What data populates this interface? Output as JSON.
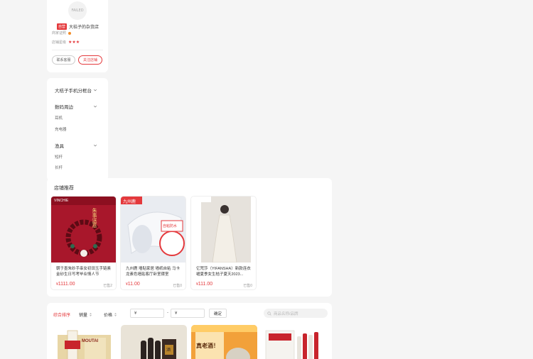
{
  "shop": {
    "logo_text": "FAILED",
    "badge": "自营",
    "name": "大桔子的杂货店",
    "rating_label_1": "商家证照",
    "rating_label_2": "店铺星级",
    "stars": "★★★",
    "btn_enter": "联系客服",
    "btn_follow": "关注店铺"
  },
  "category": {
    "header": "大桔子手机分框台",
    "group1": {
      "title": "数码周边",
      "items": [
        "耳机",
        "充电器"
      ]
    },
    "group2": {
      "title": "渔具",
      "items": [
        "短杆",
        "长杆"
      ]
    }
  },
  "recommend": {
    "title": "店铺推荐",
    "items": [
      {
        "brand": "VINCHIE",
        "img_text": "朱事送意",
        "name": "朝于墨朱砂手串女初田玉手链素金砂生日写考毕业情人节",
        "currency": "¥",
        "price": "1111.00",
        "sold": "已售2"
      },
      {
        "brand": "九州鹿",
        "img_text": "自粘防水",
        "name": "九州鹿 墙贴家居 墙纸自粘 马卡龙素色墙贴客厅卧室寝室",
        "currency": "¥",
        "price": "11.00",
        "sold": "已售0"
      },
      {
        "brand": "亿梵莎",
        "img_text": "",
        "name": "亿梵莎（YIFANSHA）新款连衣裙夏季女生桔子夏天2023...",
        "currency": "¥",
        "price": "111.00",
        "sold": "已售0"
      }
    ]
  },
  "filter": {
    "tab_all": "综合排序",
    "tab_sales": "销量",
    "tab_price": "价格",
    "min_currency": "¥",
    "max_currency": "¥",
    "dash": "-",
    "confirm": "确定",
    "search_placeholder": "商品名称/品牌"
  },
  "products": [
    {
      "label": "MOUTAI"
    },
    {
      "label": "酒"
    },
    {
      "label": "真老酒！"
    },
    {
      "label": ""
    }
  ],
  "colors": {
    "accent": "#e4393c",
    "orange": "#f28c28"
  }
}
